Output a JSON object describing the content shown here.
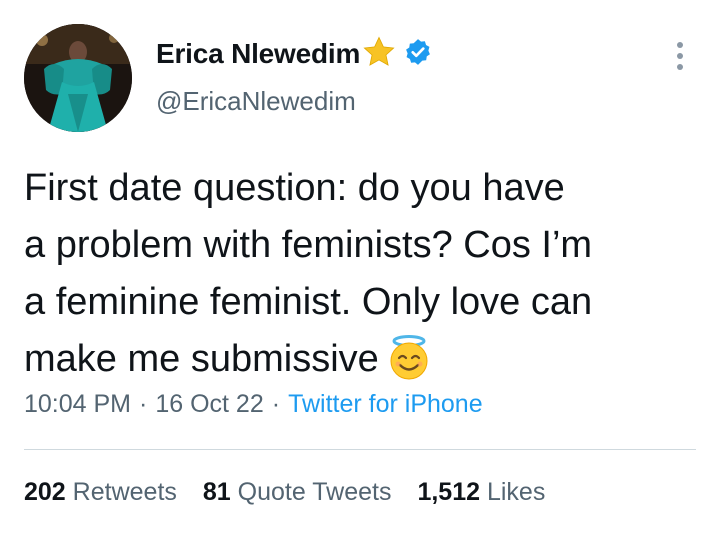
{
  "author": {
    "display_name": "Erica Nlewedim",
    "handle": "@EricaNlewedim",
    "badges": [
      "star-emoji",
      "verified-badge"
    ]
  },
  "tweet": {
    "lines": [
      "First date question: do you have",
      "a problem with feminists? Cos I’m",
      "a feminine feminist. Only love can",
      "make me submissive"
    ],
    "emoji": "smiling-face-with-halo"
  },
  "meta": {
    "time": "10:04 PM",
    "separator": "·",
    "date": "16 Oct 22",
    "source": "Twitter for iPhone"
  },
  "stats": {
    "retweets_count": "202",
    "retweets_label": "Retweets",
    "quotes_count": "81",
    "quotes_label": "Quote Tweets",
    "likes_count": "1,512",
    "likes_label": "Likes"
  },
  "colors": {
    "text": "#0f1419",
    "secondary": "#536471",
    "link": "#1d9bf0",
    "divider": "#cfd9de",
    "verified": "#1d9bf0",
    "star": "#f7c325"
  }
}
